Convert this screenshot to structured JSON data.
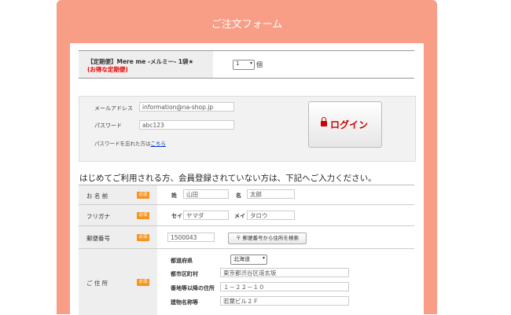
{
  "form": {
    "title": "ご注文フォーム"
  },
  "product": {
    "name": "【定期便】Mere me -メルミー- 1袋★",
    "note": "(お得な定期便)",
    "quantity": "1",
    "unit": "個"
  },
  "login": {
    "email_label": "メールアドレス",
    "email_value": "information@na-shop.jp",
    "password_label": "パスワード",
    "password_value": "abc123",
    "forgot_text": "パスワードを忘れた方は",
    "forgot_link": "こちら",
    "button_label": "ログイン"
  },
  "intro": "はじめてご利用される方、会員登録されていない方は、下記へご入力ください。",
  "required_badge": "必須",
  "fields": {
    "name": {
      "label": "お 名 前",
      "sei_label": "姓",
      "sei_value": "山田",
      "mei_label": "名",
      "mei_value": "太郎"
    },
    "kana": {
      "label": "フリガナ",
      "sei_label": "セイ",
      "sei_value": "ヤマダ",
      "mei_label": "メイ",
      "mei_value": "タロウ"
    },
    "zip": {
      "label": "郵便番号",
      "value": "1500043",
      "search_button": "〒 郵便番号から住所を検索"
    },
    "address": {
      "label": "ご 住 所",
      "pref_label": "都道府県",
      "pref_value": "北海道",
      "city_label": "都市区町村",
      "city_value": "東京都渋谷区道玄坂",
      "street_label": "番地等以降の住所",
      "street_value": "１－２２－１０",
      "building_label": "建物名称等",
      "building_value": "若葉ビル２Ｆ"
    }
  }
}
